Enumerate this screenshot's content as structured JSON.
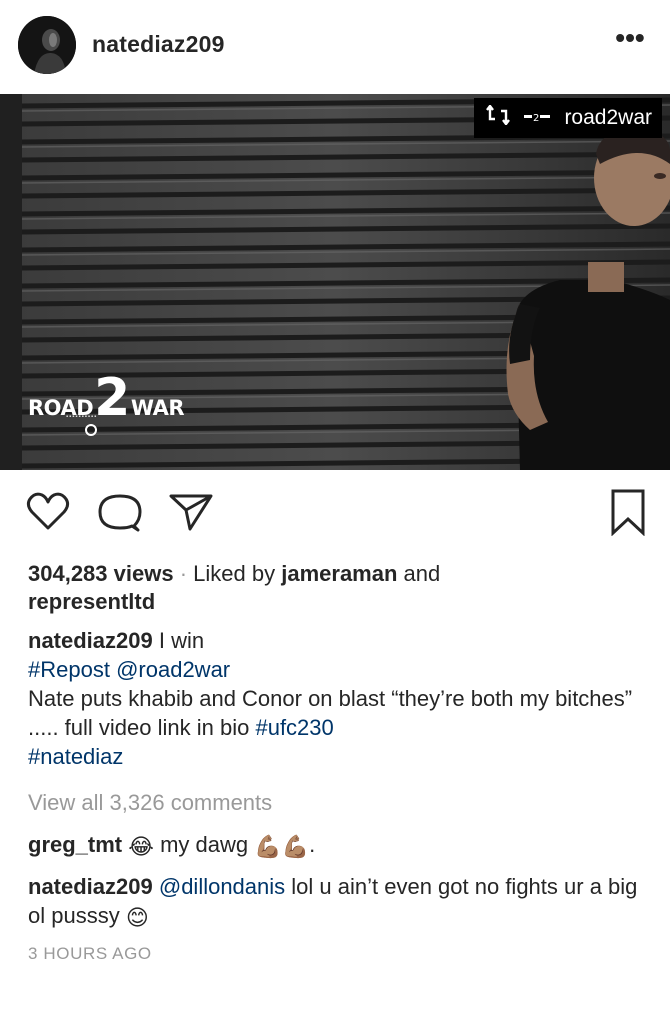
{
  "post": {
    "username": "natediaz209",
    "more_label": "•••",
    "repost_badge": {
      "icon": "repost-icon",
      "account": "road2war"
    },
    "media_logo": {
      "left": "ROAD",
      "two": "2",
      "right": "WAR"
    },
    "actions": {
      "like": "heart-icon",
      "comment": "comment-icon",
      "share": "send-icon",
      "save": "bookmark-icon"
    },
    "views": "304,283 views",
    "separator": "·",
    "liked_by_prefix": "Liked by",
    "liked_by_user": "jameraman",
    "liked_by_and": "and",
    "liked_by_other": "representltd",
    "caption": {
      "author": "natediaz209",
      "text": "I win",
      "repost_tag": "#Repost",
      "repost_mention": "@road2war",
      "body": "Nate puts khabib and Conor on blast “they’re both my bitches” ..... full video link in bio",
      "hashtag1": "#ufc230",
      "hashtag2": "#natediaz"
    },
    "view_all_comments": "View all 3,326 comments",
    "comments": [
      {
        "author": "greg_tmt",
        "emoji": "😂",
        "text": "my dawg",
        "emoji_after": "💪🏽💪🏽",
        "suffix": "."
      },
      {
        "author": "natediaz209",
        "mention": "@dillondanis",
        "text": "lol u ain’t even got no fights ur a big ol pusssy",
        "emoji_after": "😊"
      }
    ],
    "timestamp": "3 HOURS AGO"
  }
}
